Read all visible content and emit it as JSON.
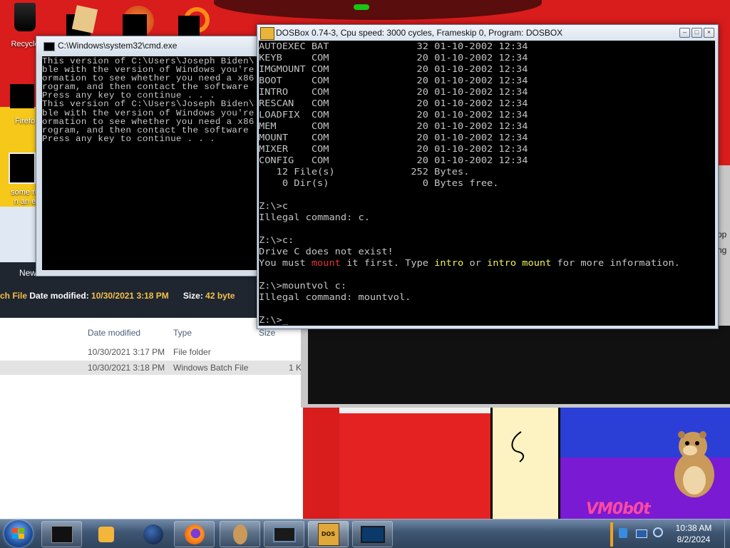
{
  "desktop": {
    "icons": [
      {
        "label": "Recycle",
        "icon": "recycle-bin-icon"
      },
      {
        "label": "Firefo",
        "icon": "firefox-icon"
      },
      {
        "label": "some ru",
        "icon": "batch-file-icon"
      },
      {
        "label": "n an e",
        "icon": "batch-file-icon"
      }
    ],
    "art_signature": "VM0b0t"
  },
  "explorer": {
    "new_label": "New",
    "details_name": "ch File",
    "details_modified_label": "Date modified:",
    "details_modified_value": "10/30/2021 3:18 PM",
    "details_size_label": "Size:",
    "details_size_value": "42 byte",
    "columns": [
      "Date modified",
      "Type",
      "Size"
    ],
    "rows": [
      {
        "date": "10/30/2021 3:17 PM",
        "type": "File folder",
        "size": ""
      },
      {
        "date": "10/30/2021 3:18 PM",
        "type": "Windows Batch File",
        "size": "1 K"
      }
    ]
  },
  "right_panel": {
    "text_1": "pp",
    "text_2": "ng"
  },
  "cmd": {
    "title": "C:\\Windows\\system32\\cmd.exe",
    "lines": [
      "This version of C:\\Users\\Joseph Biden\\",
      "ble with the version of Windows you're",
      "ormation to see whether you need a x86",
      "rogram, and then contact the software",
      "Press any key to continue . . .",
      "This version of C:\\Users\\Joseph Biden\\",
      "ble with the version of Windows you're",
      "ormation to see whether you need a x86",
      "rogram, and then contact the software",
      "Press any key to continue . . ."
    ]
  },
  "dosbox": {
    "title": "DOSBox 0.74-3, Cpu speed:    3000 cycles, Frameskip  0, Program:   DOSBOX",
    "buttons": {
      "minimize": "–",
      "maximize": "□",
      "close": "×"
    },
    "lines": {
      "l0": "AUTOEXEC BAT               32 01-10-2002 12:34",
      "l1": "KEYB     COM               20 01-10-2002 12:34",
      "l2": "IMGMOUNT COM               20 01-10-2002 12:34",
      "l3": "BOOT     COM               20 01-10-2002 12:34",
      "l4": "INTRO    COM               20 01-10-2002 12:34",
      "l5": "RESCAN   COM               20 01-10-2002 12:34",
      "l6": "LOADFIX  COM               20 01-10-2002 12:34",
      "l7": "MEM      COM               20 01-10-2002 12:34",
      "l8": "MOUNT    COM               20 01-10-2002 12:34",
      "l9": "MIXER    COM               20 01-10-2002 12:34",
      "l10": "CONFIG   COM               20 01-10-2002 12:34",
      "l11": "   12 File(s)             252 Bytes.",
      "l12": "    0 Dir(s)                0 Bytes free.",
      "l13": "",
      "l14": "Z:\\>c",
      "l15": "Illegal command: c.",
      "l16": "",
      "l17": "Z:\\>c:",
      "l18": "Drive C does not exist!",
      "l19a": "You must ",
      "l19b": "mount",
      "l19c": " it first. Type ",
      "l19d": "intro",
      "l19e": " or ",
      "l19f": "intro mount",
      "l19g": " for more information.",
      "l20": "",
      "l21": "Z:\\>mountvol c:",
      "l22": "Illegal command: mountvol.",
      "l23": "",
      "l24": "Z:\\>_"
    }
  },
  "taskbar": {
    "buttons": [
      {
        "name": "taskbar-cmd",
        "icon": "terminal-icon"
      },
      {
        "name": "taskbar-media",
        "icon": "media-player-icon"
      },
      {
        "name": "taskbar-globe",
        "icon": "globe-icon"
      },
      {
        "name": "taskbar-firefox",
        "icon": "firefox-icon"
      },
      {
        "name": "taskbar-hamster",
        "icon": "hamster-icon"
      },
      {
        "name": "taskbar-screen",
        "icon": "monitor-icon"
      },
      {
        "name": "taskbar-dosbox",
        "icon": "dosbox-icon"
      },
      {
        "name": "taskbar-window",
        "icon": "window-icon"
      }
    ],
    "dosbox_icon_text": "DOS",
    "clock_time": "10:38 AM",
    "clock_date": "8/2/2024"
  }
}
